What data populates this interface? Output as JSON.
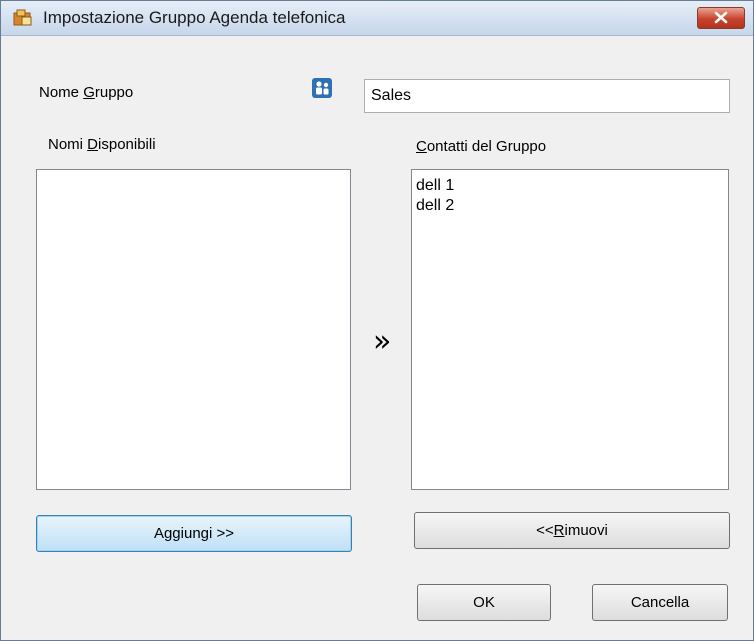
{
  "window": {
    "title": "Impostazione Gruppo Agenda telefonica"
  },
  "group_name": {
    "label_pre": "Nome ",
    "label_key": "G",
    "label_post": "ruppo",
    "value": "Sales"
  },
  "available": {
    "label_pre": "Nomi ",
    "label_key": "D",
    "label_post": "isponibili",
    "items": []
  },
  "members": {
    "label_pre": "",
    "label_key": "C",
    "label_post": "ontatti del Gruppo",
    "items": [
      "dell 1",
      "dell 2"
    ]
  },
  "transfer_arrow": "»",
  "buttons": {
    "add": "Aggiungi >>",
    "remove_pre": "<< ",
    "remove_key": "R",
    "remove_post": "imuovi",
    "ok": "OK",
    "cancel": "Cancella"
  },
  "icons": {
    "app": "phonebook-icon",
    "group": "group-people-icon",
    "close": "close-icon"
  },
  "colors": {
    "close_button": "#c7432c",
    "default_button": "#bfe0f6"
  }
}
